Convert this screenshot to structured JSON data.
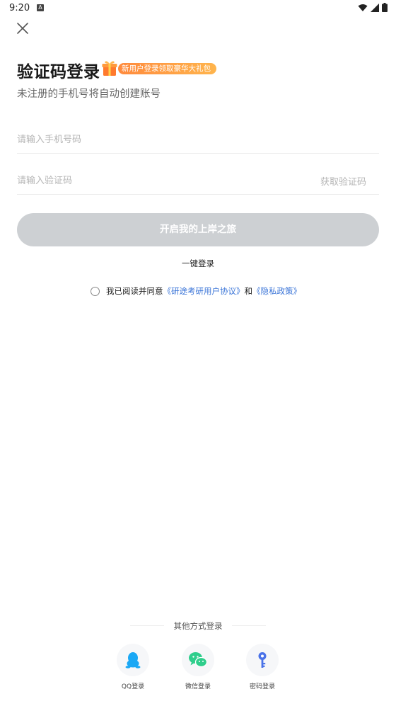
{
  "status_bar": {
    "time": "9:20",
    "notification_icon": "A"
  },
  "header": {
    "title": "验证码登录",
    "promo_text": "新用户登录领取豪华大礼包",
    "subtitle": "未注册的手机号将自动创建账号"
  },
  "form": {
    "phone_placeholder": "请输入手机号码",
    "code_placeholder": "请输入验证码",
    "get_code_label": "获取验证码",
    "submit_label": "开启我的上岸之旅",
    "one_click_label": "一键登录"
  },
  "agreement": {
    "prefix": "我已阅读并同意",
    "user_agreement": "《研途考研用户协议》",
    "and": "和",
    "privacy_policy": "《隐私政策》"
  },
  "other_login": {
    "title": "其他方式登录",
    "options": [
      {
        "label": "QQ登录",
        "icon": "qq-icon",
        "color": "#1aa8f5"
      },
      {
        "label": "微信登录",
        "icon": "wechat-icon",
        "color": "#2fce8c"
      },
      {
        "label": "密码登录",
        "icon": "key-icon",
        "color": "#4a72e8"
      }
    ]
  },
  "colors": {
    "accent_link": "#3c76d8",
    "button_disabled": "#cdd0d3",
    "promo": "#ff8a3d"
  }
}
